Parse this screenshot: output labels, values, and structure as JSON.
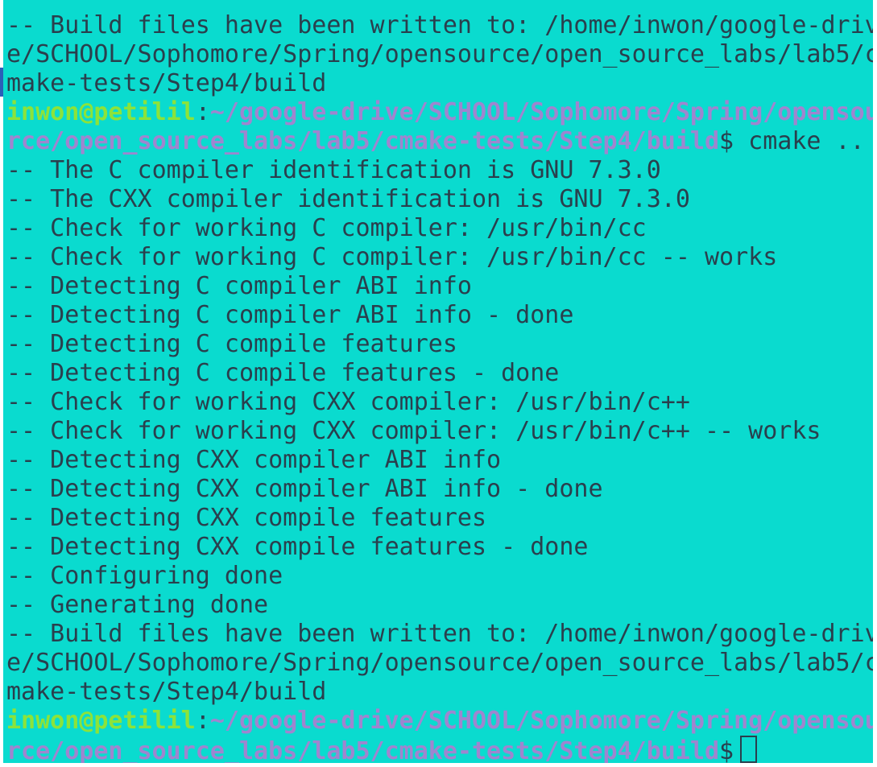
{
  "terminal": {
    "lines": [
      "-- Build files have been written to: /home/inwon/google-driv",
      "e/SCHOOL/Sophomore/Spring/opensource/open_source_labs/lab5/c",
      "make-tests/Step4/build",
      "",
      "",
      "-- The C compiler identification is GNU 7.3.0",
      "-- The CXX compiler identification is GNU 7.3.0",
      "-- Check for working C compiler: /usr/bin/cc",
      "-- Check for working C compiler: /usr/bin/cc -- works",
      "-- Detecting C compiler ABI info",
      "-- Detecting C compiler ABI info - done",
      "-- Detecting C compile features",
      "-- Detecting C compile features - done",
      "-- Check for working CXX compiler: /usr/bin/c++",
      "-- Check for working CXX compiler: /usr/bin/c++ -- works",
      "-- Detecting CXX compiler ABI info",
      "-- Detecting CXX compiler ABI info - done",
      "-- Detecting CXX compile features",
      "-- Detecting CXX compile features - done",
      "-- Configuring done",
      "-- Generating done",
      "-- Build files have been written to: /home/inwon/google-driv",
      "e/SCHOOL/Sophomore/Spring/opensource/open_source_labs/lab5/c",
      "make-tests/Step4/build"
    ],
    "prompt1": {
      "user_host": "inwon@petilil",
      "colon": ":",
      "path_part1": "~/google-drive/SCHOOL/Sophomore/Spring/opensou",
      "path_part2": "rce/open_source_labs/lab5/cmake-tests/Step4/build",
      "dollar": "$",
      "command": " cmake .."
    },
    "prompt2": {
      "user_host": "inwon@petilil",
      "colon": ":",
      "path_part1": "~/google-drive/SCHOOL/Sophomore/Spring/opensou",
      "path_part2": "rce/open_source_labs/lab5/cmake-tests/Step4/build",
      "dollar": "$"
    },
    "colors": {
      "background": "#0adbcf",
      "text": "#2a3f4d",
      "user": "#8ce33a",
      "path": "#9f85cf"
    }
  }
}
